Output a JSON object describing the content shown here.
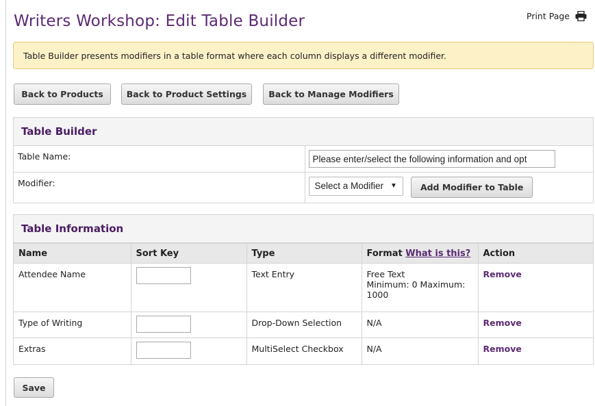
{
  "page": {
    "title": "Writers Workshop: Edit Table Builder"
  },
  "print": {
    "label": "Print Page",
    "icon": "printer-icon"
  },
  "notice": {
    "text": "Table Builder presents modifiers in a table format where each column displays a different modifier."
  },
  "nav_buttons": {
    "back_products": "Back to Products",
    "back_product_settings": "Back to Product Settings",
    "back_manage_modifiers": "Back to Manage Modifiers"
  },
  "table_builder": {
    "heading": "Table Builder",
    "table_name_label": "Table Name:",
    "table_name_value": "Please enter/select the following information and opt",
    "modifier_label": "Modifier:",
    "modifier_select": "Select a Modifier",
    "add_modifier_button": "Add Modifier to Table"
  },
  "table_information": {
    "heading": "Table Information",
    "columns": {
      "name": "Name",
      "sort_key": "Sort Key",
      "type": "Type",
      "format": "Format",
      "format_help": "What is this?",
      "action": "Action"
    },
    "rows": [
      {
        "name": "Attendee Name",
        "sort_key": "",
        "type": "Text Entry",
        "format": [
          "Free Text",
          "Minimum: 0 Maximum:",
          "1000"
        ],
        "action": "Remove"
      },
      {
        "name": "Type of Writing",
        "sort_key": "",
        "type": "Drop-Down Selection",
        "format": [
          "N/A"
        ],
        "action": "Remove"
      },
      {
        "name": "Extras",
        "sort_key": "",
        "type": "MultiSelect Checkbox",
        "format": [
          "N/A"
        ],
        "action": "Remove"
      }
    ]
  },
  "save_button": "Save",
  "colors": {
    "title": "#5b2a73",
    "notice_bg": "#fdf1c7",
    "notice_border": "#e8c77c",
    "link": "#5b2a73"
  }
}
